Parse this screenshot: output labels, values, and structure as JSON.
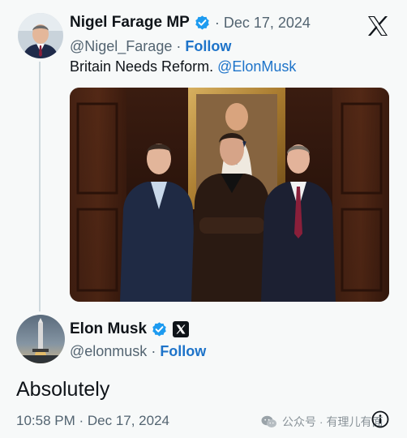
{
  "tweet": {
    "author_name": "Nigel Farage MP",
    "date": "Dec 17, 2024",
    "separator": "·",
    "handle": "@Nigel_Farage",
    "follow_label": "Follow",
    "text": "Britain Needs Reform.",
    "mention": "@ElonMusk"
  },
  "reply": {
    "author_name": "Elon Musk",
    "handle": "@elonmusk",
    "separator": "·",
    "follow_label": "Follow",
    "text": "Absolutely",
    "timestamp": "10:58 PM · Dec 17, 2024"
  },
  "watermark": {
    "text": "公众号 · 有理儿有面"
  },
  "icons": {
    "verified": "verified-badge-icon",
    "x_logo": "x-logo-icon",
    "info": "info-icon"
  },
  "colors": {
    "background": "#f7f9f9",
    "link": "#1d73c9",
    "verified": "#1d9bf0",
    "muted": "#536471"
  }
}
